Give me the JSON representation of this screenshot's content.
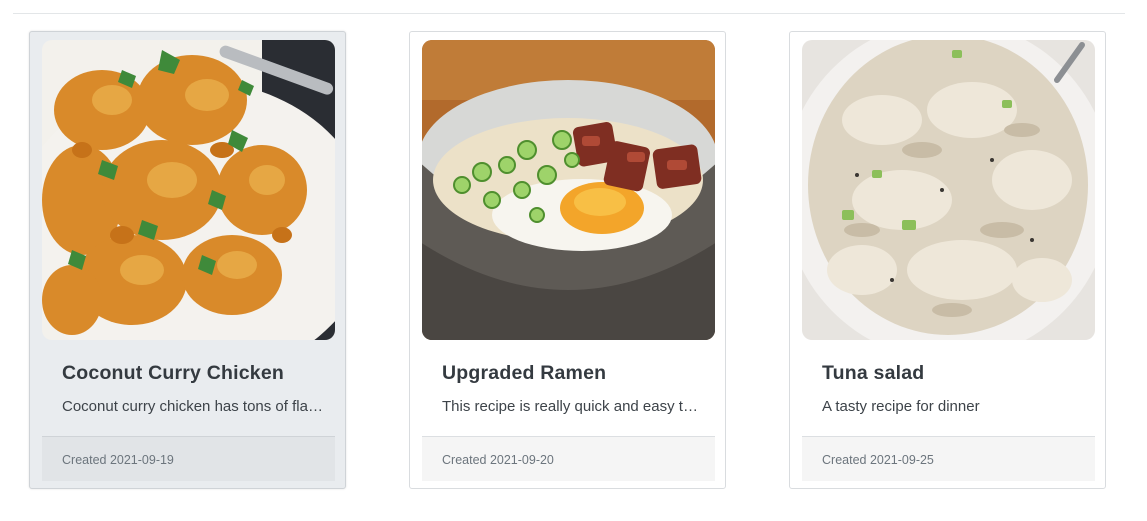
{
  "recipes": [
    {
      "title": "Coconut Curry Chicken",
      "description": "Coconut curry chicken has tons of flavor and is easy to make",
      "created": "Created 2021-09-19",
      "image_icon": "curry-chicken-photo"
    },
    {
      "title": "Upgraded Ramen",
      "description": "This recipe is really quick and easy to make",
      "created": "Created 2021-09-20",
      "image_icon": "ramen-bowl-photo"
    },
    {
      "title": "Tuna salad",
      "description": "A tasty recipe for dinner",
      "created": "Created 2021-09-25",
      "image_icon": "tuna-salad-photo"
    }
  ],
  "colors": {
    "hover_card_bg": "#e9ecef",
    "title_text": "#343a40",
    "meta_text": "#6c757d"
  }
}
